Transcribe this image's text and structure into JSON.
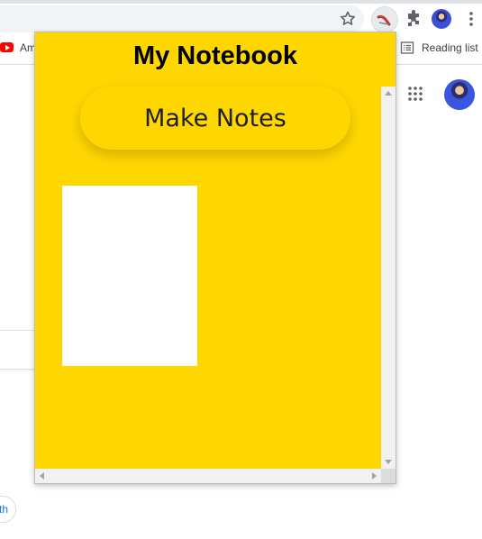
{
  "browser": {
    "bookmark_label": "Am",
    "reading_list_label": "Reading list",
    "icons": [
      "star-icon",
      "extension-icon",
      "puzzle-icon",
      "profile-avatar",
      "menu-icon",
      "youtube-icon",
      "reading-list-icon",
      "apps-icon"
    ]
  },
  "page": {
    "pill_text": "th"
  },
  "popup": {
    "title": "My Notebook",
    "make_notes_label": "Make Notes",
    "background_color": "#ffd700",
    "note_color": "#ffffff"
  }
}
